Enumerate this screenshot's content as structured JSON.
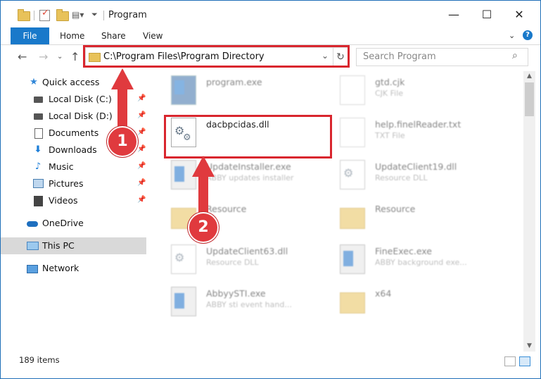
{
  "window": {
    "title": "Program",
    "minimize_label": "—",
    "maximize_label": "☐",
    "close_label": "✕"
  },
  "ribbon": {
    "tabs": [
      "File",
      "Home",
      "Share",
      "View"
    ],
    "expand_icon": "chevron-down-icon",
    "help_label": "?"
  },
  "address_bar": {
    "path": "C:\\Program Files\\Program Directory",
    "dropdown_glyph": "⌄",
    "refresh_glyph": "↻"
  },
  "search": {
    "placeholder": "Search Program",
    "icon_glyph": "⌕"
  },
  "nav": {
    "items": [
      {
        "label": "Quick access",
        "icon": "star-icon"
      },
      {
        "label": "Local Disk (C:)",
        "icon": "disk-icon"
      },
      {
        "label": "Local Disk (D:)",
        "icon": "disk-icon"
      },
      {
        "label": "Documents",
        "icon": "document-icon"
      },
      {
        "label": "Downloads",
        "icon": "download-icon"
      },
      {
        "label": "Music",
        "icon": "music-icon"
      },
      {
        "label": "Pictures",
        "icon": "pictures-icon"
      },
      {
        "label": "Videos",
        "icon": "videos-icon"
      },
      {
        "label": "OneDrive",
        "icon": "cloud-icon"
      },
      {
        "label": "This PC",
        "icon": "computer-icon"
      },
      {
        "label": "Network",
        "icon": "network-icon"
      }
    ]
  },
  "files": [
    {
      "name": "program.exe",
      "desc": ""
    },
    {
      "name": "gtd.cjk",
      "desc": "CJK File"
    },
    {
      "name": "dacbpcidas.dll",
      "desc": ""
    },
    {
      "name": "help.finelReader.txt",
      "desc": "TXT File"
    },
    {
      "name": "UpdateInstaller.exe",
      "desc": "ABBY updates installer"
    },
    {
      "name": "UpdateClient19.dll",
      "desc": "Resource DLL"
    },
    {
      "name": "Resource",
      "desc": ""
    },
    {
      "name": "Resource",
      "desc": ""
    },
    {
      "name": "UpdateClient63.dll",
      "desc": "Resource DLL"
    },
    {
      "name": "FineExec.exe",
      "desc": "ABBY background exe..."
    },
    {
      "name": "AbbyySTI.exe",
      "desc": "ABBY sti event hand..."
    },
    {
      "name": "x64",
      "desc": ""
    }
  ],
  "annotations": {
    "step1": "1",
    "step2": "2",
    "highlight_color": "#d9262e",
    "arrow_color": "#e03a3e"
  },
  "status": {
    "item_count": "189 items"
  },
  "colors": {
    "accent": "#1979ca",
    "selection": "#d9d9d9"
  }
}
